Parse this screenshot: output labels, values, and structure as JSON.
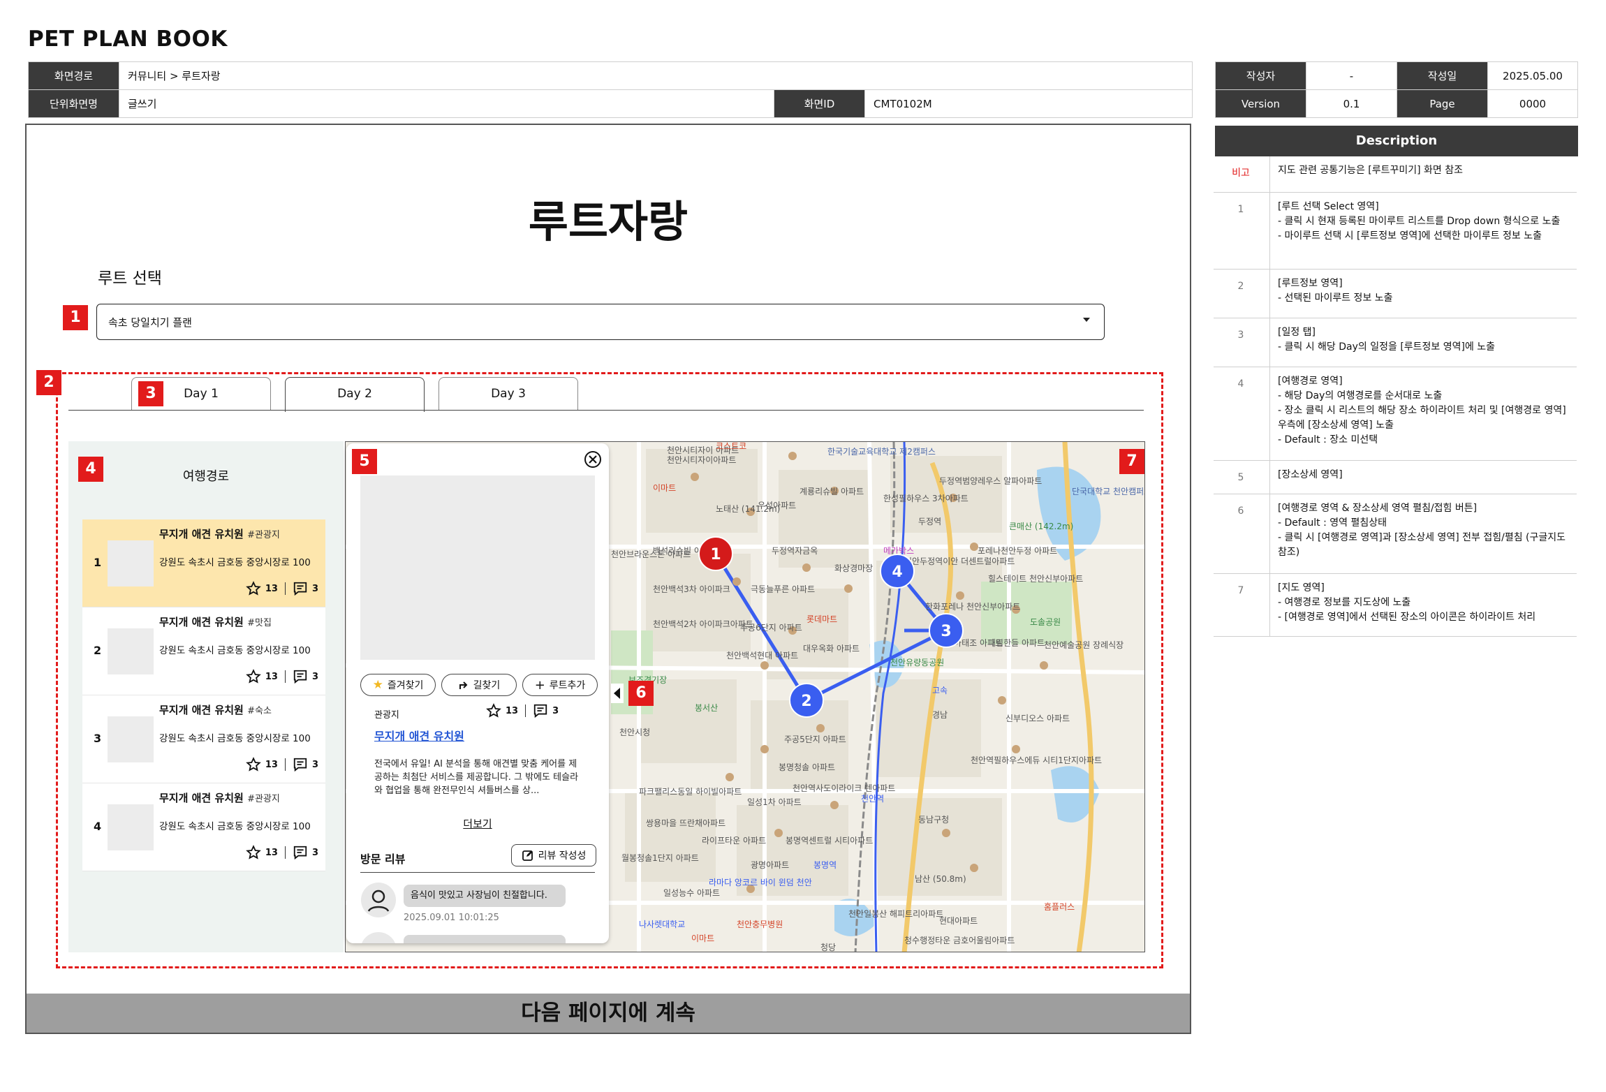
{
  "doc_title": "PET PLAN BOOK",
  "meta": {
    "path_label": "화면경로",
    "path_value": "커뮤니티 > 루트자랑",
    "unit_label": "단위화면명",
    "unit_value": "글쓰기",
    "id_label": "화면ID",
    "id_value": "CMT0102M",
    "author_label": "작성자",
    "author_value": "-",
    "date_label": "작성일",
    "date_value": "2025.05.00",
    "version_label": "Version",
    "version_value": "0.1",
    "page_label": "Page",
    "page_value": "0000"
  },
  "screen": {
    "title": "루트자랑",
    "route_select_label": "루트 선택",
    "select_value": "속초 당일치기 플랜",
    "tabs": [
      "Day 1",
      "Day 2",
      "Day 3"
    ],
    "active_tab": "Day 2",
    "left_panel_title": "여행경로",
    "items": [
      {
        "num": "1",
        "name": "무지개 애견 유치원",
        "tag": "#관광지",
        "address": "강원도 속초시 금호동 중앙시장로 100",
        "stars": "13",
        "comments": "3"
      },
      {
        "num": "2",
        "name": "무지개 애견 유치원",
        "tag": "#맛집",
        "address": "강원도 속초시 금호동 중앙시장로 100",
        "stars": "13",
        "comments": "3"
      },
      {
        "num": "3",
        "name": "무지개 애견 유치원",
        "tag": "#숙소",
        "address": "강원도 속초시 금호동 중앙시장로 100",
        "stars": "13",
        "comments": "3"
      },
      {
        "num": "4",
        "name": "무지개 애견 유치원",
        "tag": "#관광지",
        "address": "강원도 속초시 금호동 중앙시장로 100",
        "stars": "13",
        "comments": "3"
      }
    ],
    "detail": {
      "favorite_label": "즐겨찾기",
      "directions_label": "길찾기",
      "add_route_label": "루트추가",
      "category": "관광지",
      "stars": "13",
      "comments": "3",
      "place_name": "무지개 애견 유치원",
      "description": "전국에서 유일! AI 분석을 통해 애견별 맞춤 케어를 제공하는 최첨단 서비스를 제공합니다. 그 밖에도 테슬라와 협업을 통해 완전무인식 셔틀버스를 상...",
      "more_label": "더보기",
      "review_title": "방문 리뷰",
      "write_review_label": "리뷰 작성성",
      "review_text": "음식이 맛있고 사장님이 친절합니다.",
      "review_time": "2025.09.01 10:01:25"
    },
    "markers": [
      {
        "label": "1",
        "color": "#d41a1a"
      },
      {
        "label": "2",
        "color": "#3a5ef0"
      },
      {
        "label": "3",
        "color": "#3a5ef0"
      },
      {
        "label": "4",
        "color": "#3a5ef0"
      }
    ],
    "map_labels": [
      "천안시티자이 아파트",
      "한국기술교육대학교 제2캠퍼스",
      "노태산 (141.2m)",
      "우성아파트",
      "계룡리슈빌 아파트",
      "한성필하우스 3차아파트",
      "두정역",
      "두정역범양레우스 알파아파트",
      "메가박스",
      "화상경마장",
      "천안두정역이안 더센트럴아파트",
      "포레나천안두정 아파트",
      "힐스테이트 천안신부아파트",
      "한화포레나 천안신부아파트",
      "백석리슈빌 아파트",
      "천안브라운스톤 아파트",
      "천안백석3차 아이파크",
      "극동늘푸른 아파트",
      "롯데마트",
      "주공6단지 아파트",
      "대우옥화 아파트",
      "천안백석2차 아이파크아파트",
      "천안백석현대 아파트",
      "보조경기장",
      "봉서산",
      "천안시청",
      "주공5단지 아파트",
      "봉명청솔 아파트",
      "천안역사도이라이크 텐아파트",
      "천안역",
      "동남구청",
      "일성1차 아파트",
      "파크팰리스동일 하이빌아파트",
      "쌍용마을 뜨란채아파트",
      "라이프타운 아파트",
      "봉명역센트럴 시티아파트",
      "광명아파트",
      "봉명역",
      "남산 (50.8m)",
      "일성능수 아파트",
      "나사렛대학교",
      "천안충무병원",
      "이마트",
      "천안일봉산 해피트리아파트",
      "현대아파트",
      "청수행정타운 금호어울림아파트",
      "청당",
      "신부디오스 아파트",
      "천안역필하우스에듀 시티1단지아파트",
      "동아태조 아파트",
      "대림한들 아파트",
      "도솔공원",
      "천안예술공원 장례식장",
      "단국대학교 천안캠퍼스",
      "큰매산 (142.2m)",
      "홈플러스",
      "천안유량동공원",
      "고속",
      "경남",
      "월봉청솔1단지 아파트",
      "라마다 앙코르 바이 윈덤 천안",
      "두정역자금옥",
      "이마트",
      "코스트코",
      "천안시티자이아파트"
    ],
    "continue_label": "다음 페이지에 계속"
  },
  "badges": [
    "1",
    "2",
    "3",
    "4",
    "5",
    "6",
    "7"
  ],
  "description": {
    "header": "Description",
    "rows": [
      {
        "n": "비고",
        "lines": [
          "지도 관련 공통기능은 [루트꾸미기] 화면 참조"
        ]
      },
      {
        "n": "1",
        "lines": [
          "[루트 선택 Select 영역]",
          "- 클릭 시 현재 등록된 마이루트 리스트를 Drop down 형식으로 노출",
          "- 마이루트 선택 시 [루트정보 영역]에 선택한 마이루트 정보 노출"
        ]
      },
      {
        "n": "2",
        "lines": [
          "[루트정보 영역]",
          "- 선택된 마이루트 정보 노출"
        ]
      },
      {
        "n": "3",
        "lines": [
          "[일정 탭]",
          "- 클릭 시 해당 Day의 일정을 [루트정보 영역]에 노출"
        ]
      },
      {
        "n": "4",
        "lines": [
          "[여행경로 영역]",
          "- 해당 Day의 여행경로를 순서대로 노출",
          "- 장소 클릭 시 리스트의 해당 장소 하이라이트 처리 및 [여행경로 영역] 우측에 [장소상세 영역] 노출",
          "- Default : 장소 미선택"
        ]
      },
      {
        "n": "5",
        "lines": [
          "[장소상세 영역]"
        ]
      },
      {
        "n": "6",
        "lines": [
          "[여행경로 영역 & 장소상세 영역 펼침/접힘 버튼]",
          "- Default : 영역 펼침상태",
          "- 클릭 시 [여행경로 영역]과 [장소상세 영역] 전부 접힘/펼침 (구글지도 참조)"
        ]
      },
      {
        "n": "7",
        "lines": [
          "[지도 영역]",
          "- 여행경로 정보를 지도상에 노출",
          "- [여행경로 영역]에서 선택된 장소의 아이콘은 하이라이트 처리"
        ]
      }
    ]
  },
  "colors": {
    "accent_red": "#e21b1b",
    "highlight": "#fde6ad",
    "marker_blue": "#3a5ef0",
    "marker_red": "#d41a1a",
    "header_dark": "#3a3a3a"
  }
}
